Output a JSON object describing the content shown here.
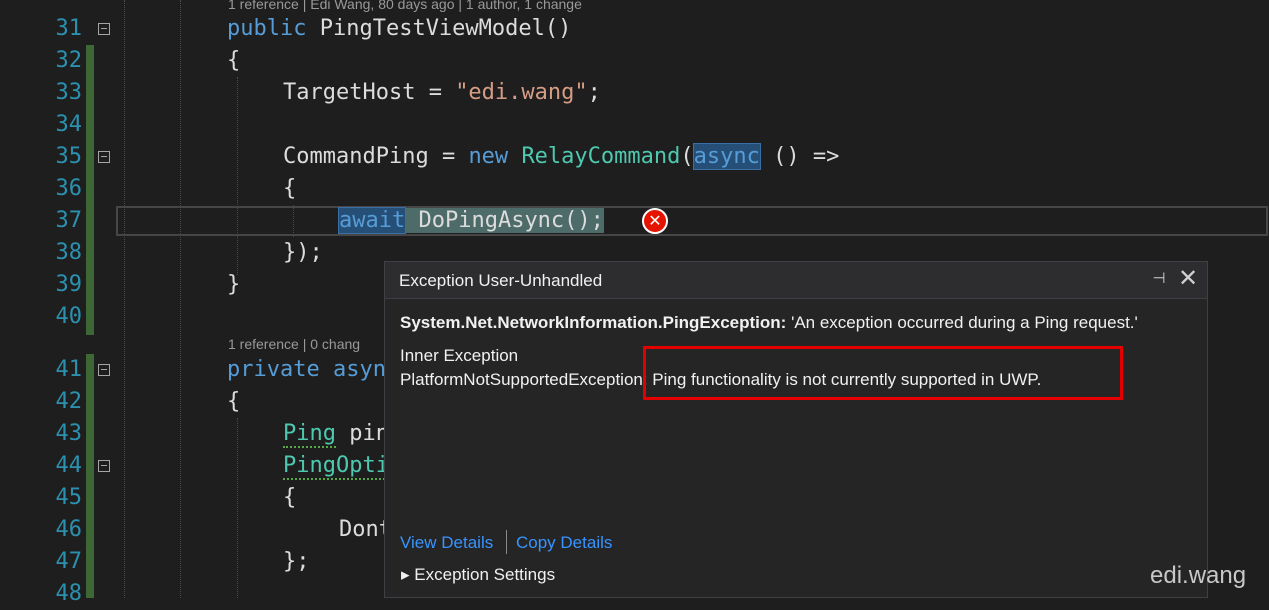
{
  "editor": {
    "line_numbers": [
      "31",
      "32",
      "33",
      "34",
      "35",
      "36",
      "37",
      "38",
      "39",
      "40",
      "41",
      "42",
      "43",
      "44",
      "45",
      "46",
      "47",
      "48"
    ],
    "codelens1": "1 reference | Edi Wang, 80 days ago | 1 author, 1 change",
    "codelens2": "1 reference | 0 chang",
    "code": {
      "l31_kw": "public",
      "l31_rest": " PingTestViewModel()",
      "l32": "{",
      "l33_a": "TargetHost = ",
      "l33_str": "\"edi.wang\"",
      "l33_b": ";",
      "l35_a": "CommandPing = ",
      "l35_new": "new",
      "l35_sp": " ",
      "l35_type": "RelayCommand",
      "l35_paren": "(",
      "l35_async": "async",
      "l35_rest": " () =>",
      "l36": "{",
      "l37_await": "await",
      "l37_rest": " DoPingAsync();",
      "l38": "});",
      "l39": "}",
      "l41_kw": "private",
      "l41_rest": " asyn",
      "l42": "{",
      "l43_type": "Ping",
      "l43_rest": " pin",
      "l44_type": "PingOpti",
      "l45": "{",
      "l46": "Dont",
      "l47": "};"
    }
  },
  "popup": {
    "title": "Exception User-Unhandled",
    "exception_type": "System.Net.NetworkInformation.PingException:",
    "exception_message": " 'An exception occurred during a Ping request.'",
    "inner_label": "Inner Exception",
    "inner_type": "PlatformNotSupportedException",
    "inner_message": ": Ping functionality is not currently supported in UWP.",
    "view_details": "View Details",
    "copy_details": "Copy Details",
    "exception_settings": "Exception Settings",
    "pin_glyph": "⊣",
    "close_glyph": "✕",
    "expand_glyph": "▸"
  },
  "watermark": "edi.wang",
  "colors": {
    "background": "#1e1e1e",
    "line_number": "#2b91af",
    "keyword": "#569cd6",
    "type": "#4ec9b0",
    "string": "#d69d85",
    "link": "#3794ff",
    "error": "#e51400",
    "highlight_box": "#e50000"
  }
}
